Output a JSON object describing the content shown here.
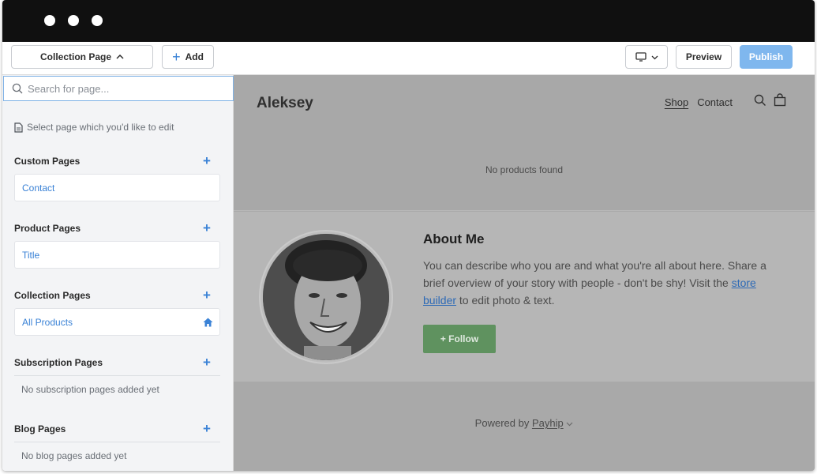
{
  "toolbar": {
    "page_selector_label": "Collection Page",
    "add_label": "Add",
    "preview_label": "Preview",
    "publish_label": "Publish"
  },
  "sidebar": {
    "search_placeholder": "Search for page...",
    "hint": "Select page which you'd like to edit",
    "sections": {
      "custom": {
        "title": "Custom Pages",
        "items": [
          "Contact"
        ]
      },
      "product": {
        "title": "Product Pages",
        "items": [
          "Title"
        ]
      },
      "collection": {
        "title": "Collection Pages",
        "items": [
          "All Products"
        ]
      },
      "subscription": {
        "title": "Subscription Pages",
        "empty": "No subscription pages added yet"
      },
      "blog": {
        "title": "Blog Pages",
        "empty": "No blog pages added yet"
      }
    }
  },
  "store": {
    "name": "Aleksey",
    "nav": [
      "Shop",
      "Contact"
    ],
    "no_products": "No products found",
    "about": {
      "title": "About Me",
      "text_before": "You can describe who you are and what you're all about here. Share a brief overview of your story with people - don't be shy! Visit the ",
      "link": "store builder",
      "text_after": " to edit photo & text.",
      "follow_label": "+ Follow"
    },
    "footer": {
      "powered_prefix": "Powered by ",
      "brand": "Payhip"
    }
  },
  "colors": {
    "accent": "#3a82d6",
    "publish": "#7fb7ee",
    "follow": "#5f925f",
    "titlebar": "#101010"
  }
}
